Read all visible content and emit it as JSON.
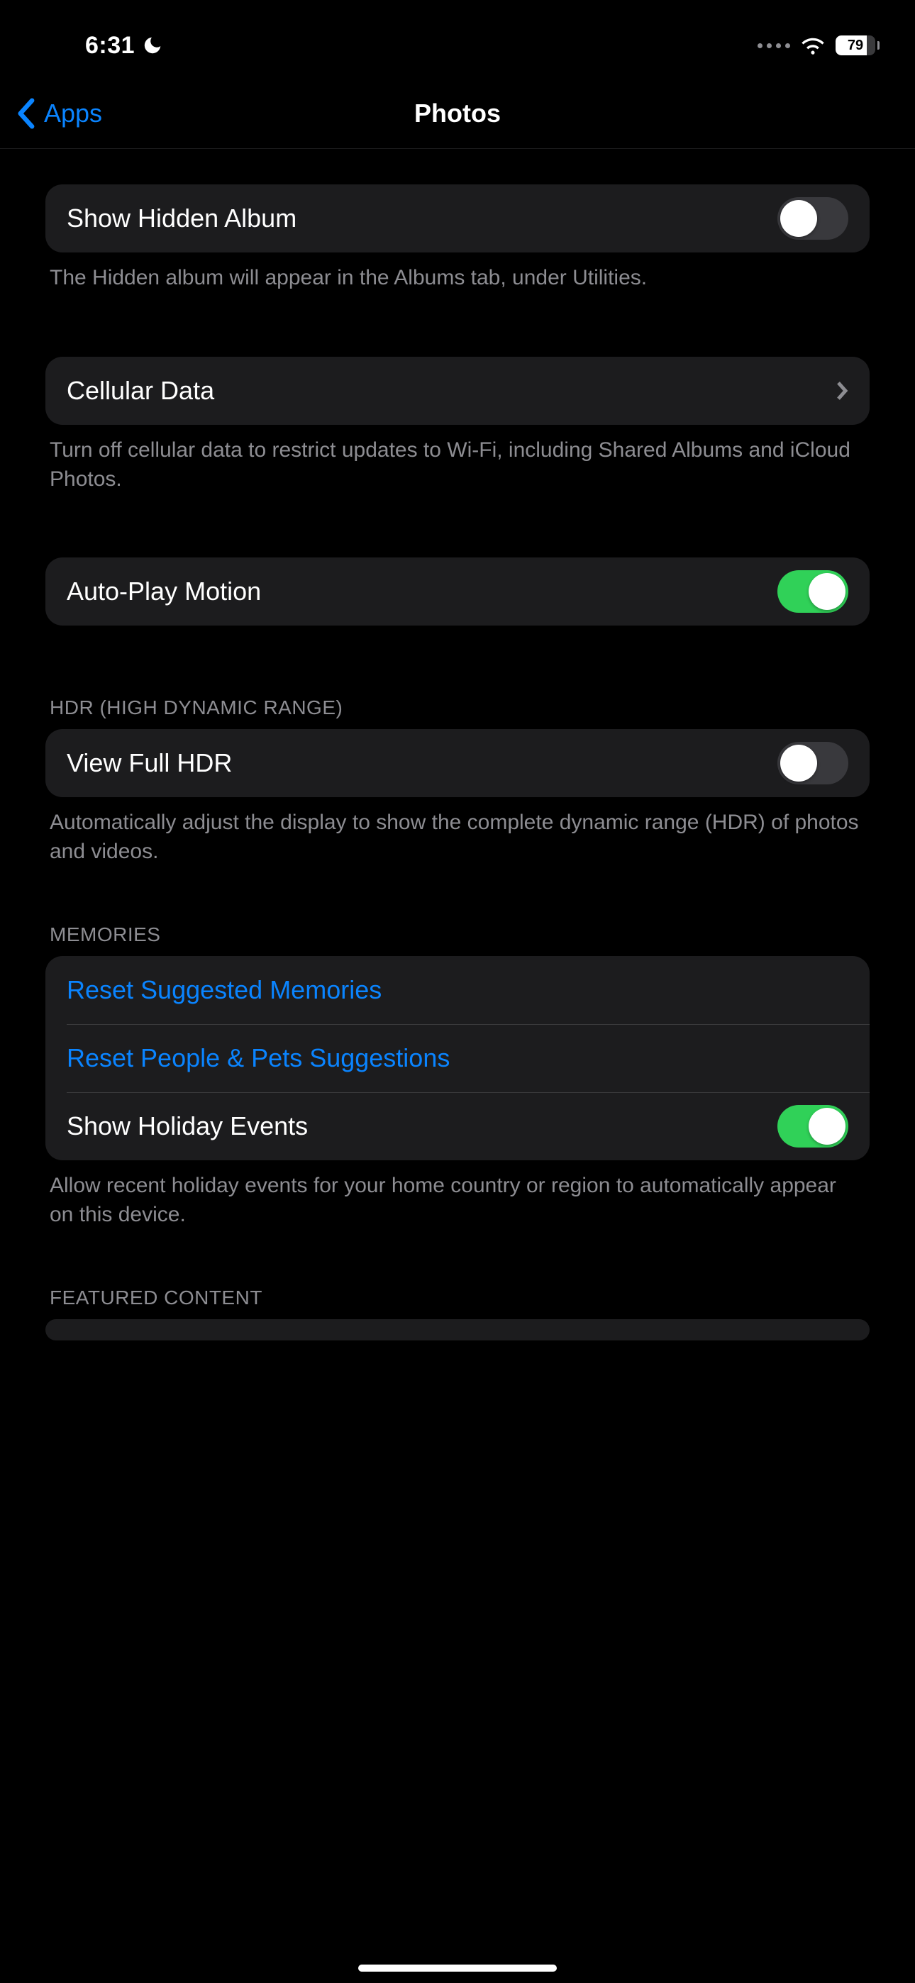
{
  "status": {
    "time": "6:31",
    "battery_pct": "79"
  },
  "nav": {
    "back_label": "Apps",
    "title": "Photos"
  },
  "rows": {
    "show_hidden_album": {
      "label": "Show Hidden Album",
      "on": false,
      "footer": "The Hidden album will appear in the Albums tab, under Utilities."
    },
    "cellular_data": {
      "label": "Cellular Data",
      "footer": "Turn off cellular data to restrict updates to Wi-Fi, including Shared Albums and iCloud Photos."
    },
    "auto_play_motion": {
      "label": "Auto-Play Motion",
      "on": true
    },
    "hdr": {
      "header": "HDR (HIGH DYNAMIC RANGE)",
      "view_full_hdr_label": "View Full HDR",
      "view_full_hdr_on": false,
      "footer": "Automatically adjust the display to show the complete dynamic range (HDR) of photos and videos."
    },
    "memories": {
      "header": "MEMORIES",
      "reset_suggested": "Reset Suggested Memories",
      "reset_people_pets": "Reset People & Pets Suggestions",
      "show_holiday_events_label": "Show Holiday Events",
      "show_holiday_events_on": true,
      "footer": "Allow recent holiday events for your home country or region to automatically appear on this device."
    },
    "featured_content": {
      "header": "FEATURED CONTENT"
    }
  }
}
